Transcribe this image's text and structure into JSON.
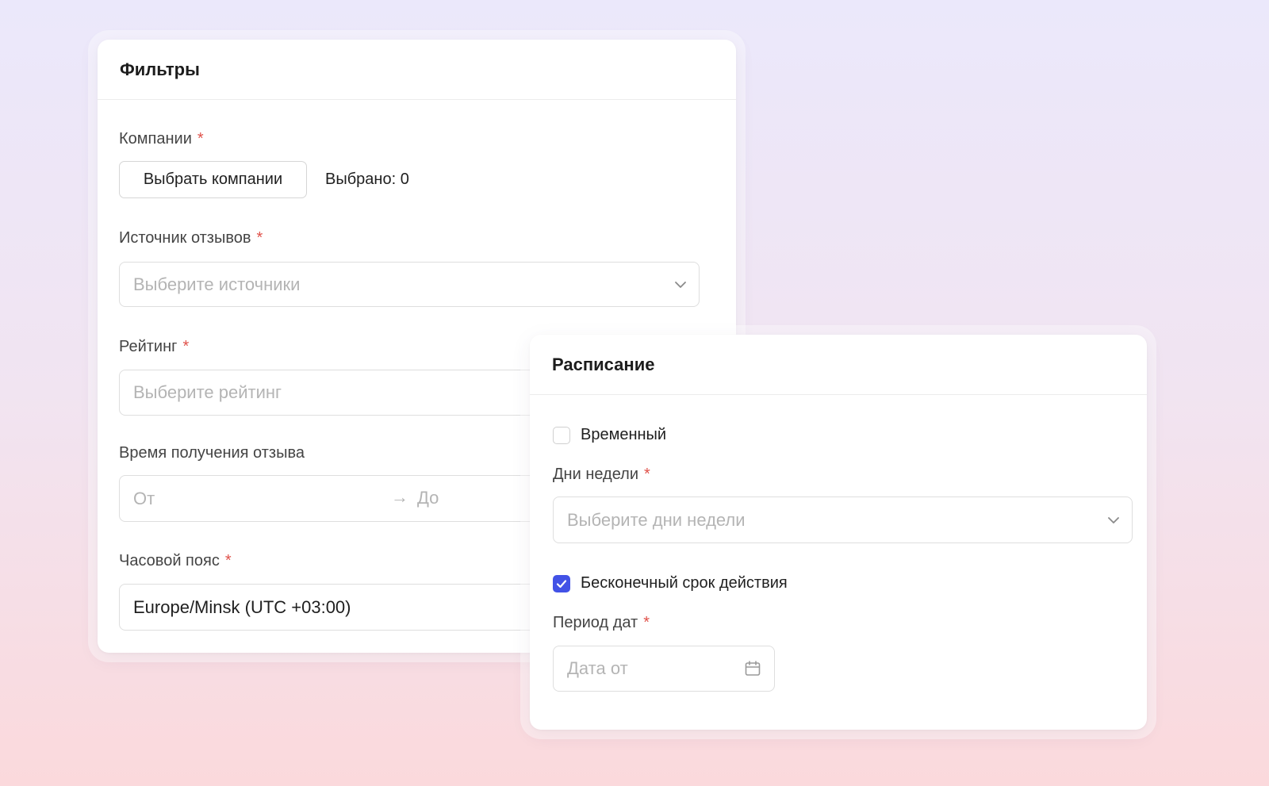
{
  "filters": {
    "title": "Фильтры",
    "companies": {
      "label": "Компании",
      "required_mark": "*",
      "button_label": "Выбрать компании",
      "selected_text": "Выбрано: 0"
    },
    "review_source": {
      "label": "Источник отзывов",
      "required_mark": "*",
      "placeholder": "Выберите источники"
    },
    "rating": {
      "label": "Рейтинг",
      "required_mark": "*",
      "placeholder": "Выберите рейтинг"
    },
    "review_time": {
      "label": "Время получения отзыва",
      "from_placeholder": "От",
      "arrow": "→",
      "to_placeholder": "До"
    },
    "timezone": {
      "label": "Часовой пояс",
      "required_mark": "*",
      "value": "Europe/Minsk (UTC +03:00)"
    }
  },
  "schedule": {
    "title": "Расписание",
    "temporary": {
      "label": "Временный",
      "checked": false
    },
    "weekdays": {
      "label": "Дни недели",
      "required_mark": "*",
      "placeholder": "Выберите дни недели"
    },
    "infinite": {
      "label": "Бесконечный срок действия",
      "checked": true
    },
    "date_period": {
      "label": "Период дат",
      "required_mark": "*",
      "placeholder": "Дата от"
    }
  },
  "colors": {
    "accent": "#4252e6",
    "required": "#e0524b",
    "placeholder": "#b4b4b4",
    "border": "#dedede"
  },
  "icons": {
    "dropdown": "chevron-down-icon",
    "checkbox_checked": "check-icon",
    "date": "calendar-icon"
  }
}
